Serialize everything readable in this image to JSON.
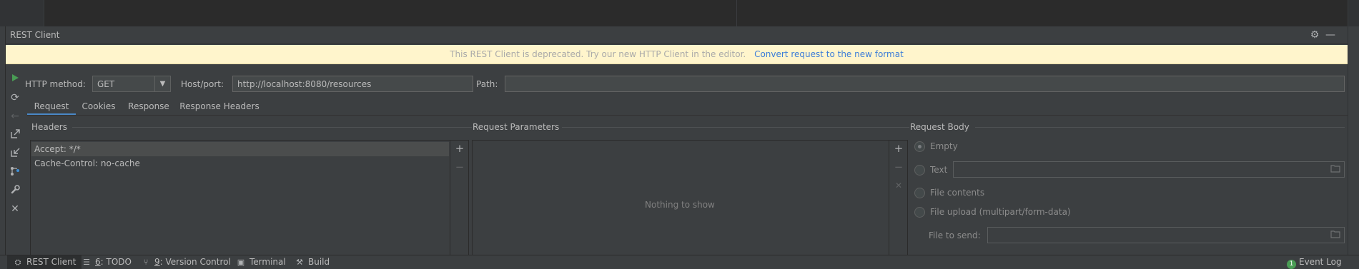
{
  "tool_window": {
    "title": "REST Client"
  },
  "banner": {
    "message": "This REST Client is deprecated. Try our new HTTP Client in the editor.",
    "link": "Convert request to the new format"
  },
  "form": {
    "method_label": "HTTP method:",
    "method_value": "GET",
    "host_label": "Host/port:",
    "host_value": "http://localhost:8080/resources",
    "path_label": "Path:",
    "path_value": ""
  },
  "tabs": [
    "Request",
    "Cookies",
    "Response",
    "Response Headers"
  ],
  "headers": {
    "title": "Headers",
    "items": [
      "Accept: */*",
      "Cache-Control: no-cache"
    ]
  },
  "params": {
    "title": "Request Parameters",
    "empty_text": "Nothing to show"
  },
  "body": {
    "title": "Request Body",
    "options": [
      "Empty",
      "Text",
      "File contents",
      "File upload (multipart/form-data)"
    ],
    "selected": "Empty",
    "file_to_send_label": "File to send:"
  },
  "statusbar": {
    "rest_client": "REST Client",
    "todo_num": "6",
    "todo_label": ": TODO",
    "vc_num": "9",
    "vc_label": ": Version Control",
    "terminal": "Terminal",
    "build": "Build",
    "event_count": "1",
    "event_log": "Event Log"
  },
  "icons": {
    "run": "run-icon",
    "refresh": "refresh-icon",
    "back": "back-arrow-icon",
    "export": "export-icon",
    "import": "import-icon",
    "generate": "generate-icon",
    "settings": "wrench-icon",
    "close": "close-icon"
  },
  "colors": {
    "run_green": "#499c54",
    "link_blue": "#3d7dd8",
    "banner_bg": "#fff5cc",
    "tab_underline": "#4a88c7"
  }
}
